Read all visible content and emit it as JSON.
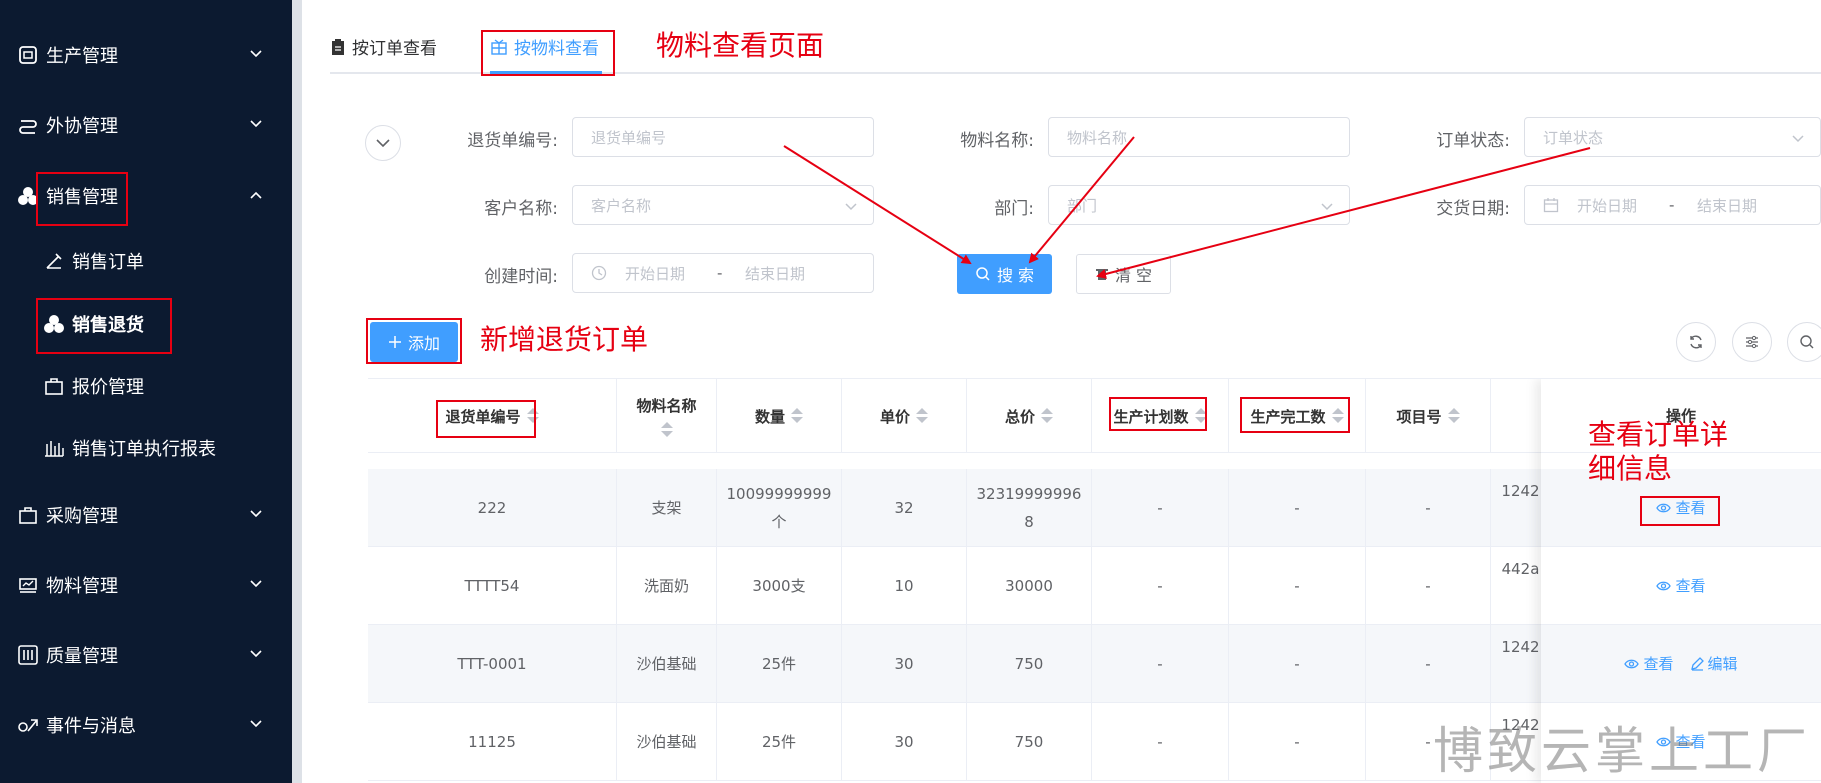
{
  "sidebar": {
    "menus": [
      {
        "label": "生产管理",
        "icon": "production-icon"
      },
      {
        "label": "外协管理",
        "icon": "outsourcing-icon"
      },
      {
        "label": "销售管理",
        "icon": "sales-icon"
      },
      {
        "label": "采购管理",
        "icon": "purchase-icon"
      },
      {
        "label": "物料管理",
        "icon": "material-icon"
      },
      {
        "label": "质量管理",
        "icon": "quality-icon"
      },
      {
        "label": "事件与消息",
        "icon": "event-icon"
      }
    ],
    "sales_sub": [
      {
        "label": "销售订单"
      },
      {
        "label": "销售退货"
      },
      {
        "label": "报价管理"
      },
      {
        "label": "销售订单执行报表"
      }
    ]
  },
  "tabs": [
    {
      "label": "按订单查看"
    },
    {
      "label": "按物料查看"
    }
  ],
  "annotations": {
    "material_page": "物料查看页面",
    "add_return": "新增退货订单",
    "view_detail_1": "查看订单详",
    "view_detail_2": "细信息"
  },
  "form": {
    "return_no": {
      "label": "退货单编号:",
      "placeholder": "退货单编号"
    },
    "material_name": {
      "label": "物料名称:",
      "placeholder": "物料名称"
    },
    "order_status": {
      "label": "订单状态:",
      "placeholder": "订单状态"
    },
    "customer_name": {
      "label": "客户名称:",
      "placeholder": "客户名称"
    },
    "department": {
      "label": "部门:",
      "placeholder": "部门"
    },
    "delivery_date": {
      "label": "交货日期:",
      "start": "开始日期",
      "sep": "-",
      "end": "结束日期"
    },
    "create_time": {
      "label": "创建时间:",
      "start": "开始日期",
      "sep": "-",
      "end": "结束日期"
    },
    "search_label": "搜 索",
    "clear_label": "清 空"
  },
  "toolbar": {
    "add_label": "添加"
  },
  "table": {
    "columns": [
      "退货单编号",
      "物料名称",
      "数量",
      "单价",
      "总价",
      "生产计划数",
      "生产完工数",
      "项目号",
      "",
      "操作"
    ],
    "rows": [
      {
        "no": "222",
        "material": "支架",
        "qty": [
          "10099999999",
          "个"
        ],
        "price": "32",
        "total": [
          "32319999996",
          "8"
        ],
        "plan": "-",
        "done": "-",
        "project": "-",
        "extra": "1242",
        "ops": [
          "查看"
        ]
      },
      {
        "no": "TTTT54",
        "material": "洗面奶",
        "qty": [
          "3000支"
        ],
        "price": "10",
        "total": [
          "30000"
        ],
        "plan": "-",
        "done": "-",
        "project": "-",
        "extra": "442a",
        "ops": [
          "查看"
        ]
      },
      {
        "no": "TTT-0001",
        "material": "沙伯基础",
        "qty": [
          "25件"
        ],
        "price": "30",
        "total": [
          "750"
        ],
        "plan": "-",
        "done": "-",
        "project": "-",
        "extra": "1242",
        "ops": [
          "查看",
          "编辑"
        ]
      },
      {
        "no": "11125",
        "material": "沙伯基础",
        "qty": [
          "25件"
        ],
        "price": "30",
        "total": [
          "750"
        ],
        "plan": "-",
        "done": "-",
        "project": "-",
        "extra": "1242",
        "ops": [
          "查看"
        ]
      }
    ]
  },
  "watermark": "博致云掌上工厂",
  "colors": {
    "sidebar_bg": "#0c1a30",
    "primary": "#409eff",
    "annotation": "#e60012"
  }
}
